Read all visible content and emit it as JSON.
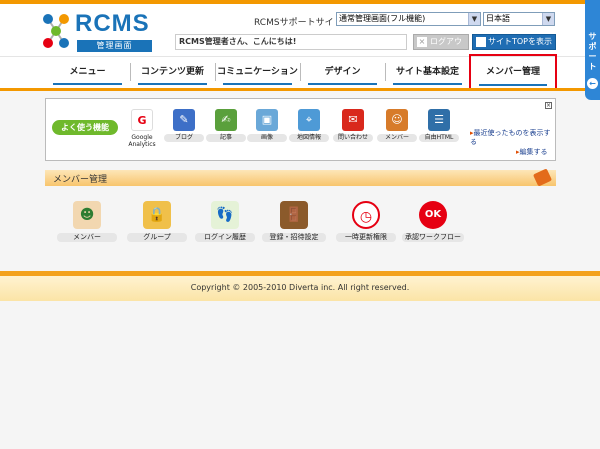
{
  "header": {
    "logo_text": "RCMS",
    "logo_sub": "管理画面",
    "site_label": "RCMSサポートサイト",
    "site_select": "通常管理画面(フル機能)",
    "lang_select": "日本語",
    "greeting": "RCMS管理者さん、こんにちは!",
    "logout_label": "ログアウト",
    "site_top_label": "サイトTOPを表示"
  },
  "support_tab": {
    "label": "サポート"
  },
  "nav": {
    "items": [
      "メニュー",
      "コンテンツ更新",
      "コミュニケーション",
      "デザイン",
      "サイト基本設定",
      "メンバー管理"
    ],
    "active": "メンバー管理"
  },
  "quick": {
    "label": "よく使う機能",
    "items": [
      {
        "label": "Google Analytics",
        "icon": "google-analytics-icon"
      },
      {
        "label": "ブログ",
        "icon": "blog-icon"
      },
      {
        "label": "記事",
        "icon": "article-icon"
      },
      {
        "label": "画像",
        "icon": "image-icon"
      },
      {
        "label": "地図情報",
        "icon": "map-icon"
      },
      {
        "label": "問い合わせ",
        "icon": "inquiry-icon"
      },
      {
        "label": "メンバー",
        "icon": "member-icon"
      },
      {
        "label": "自由HTML",
        "icon": "free-html-icon"
      }
    ],
    "recent_link": "最近使ったものを表示する",
    "edit_link": "編集する"
  },
  "section": {
    "title": "メンバー管理"
  },
  "member_menu": [
    {
      "label": "メンバー",
      "icon": "members-icon"
    },
    {
      "label": "グループ",
      "icon": "group-lock-icon"
    },
    {
      "label": "ログイン履歴",
      "icon": "footprints-icon"
    },
    {
      "label": "登録・招待設定",
      "icon": "invitation-door-icon"
    },
    {
      "label": "一時更新権限",
      "icon": "clock-permission-icon"
    },
    {
      "label": "承認ワークフロー",
      "icon": "ok-approval-icon"
    }
  ],
  "footer": {
    "copyright": "Copyright © 2005-2010 Diverta inc. All right reserved."
  },
  "colors": {
    "accent": "#f39800",
    "brand_blue": "#1a73b8",
    "highlight_red": "#e60012",
    "quick_green": "#6fb92c"
  }
}
